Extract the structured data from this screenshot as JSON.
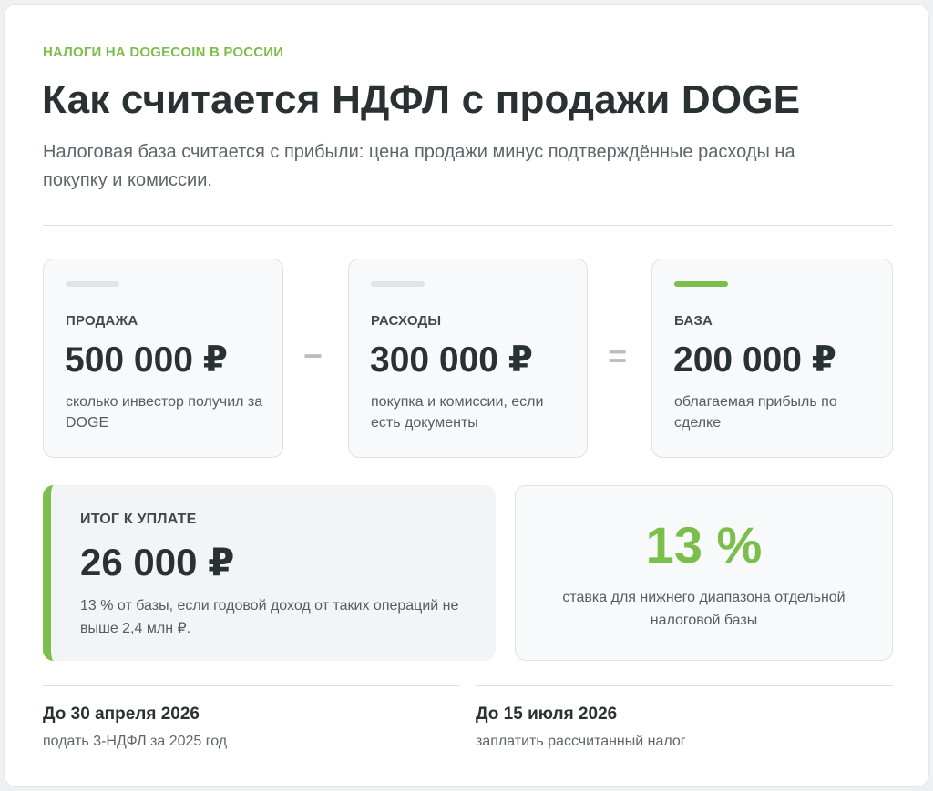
{
  "header": {
    "eyebrow": "НАЛОГИ НА DOGECOIN В РОССИИ",
    "title": "Как считается НДФЛ с продажи DOGE",
    "subtitle": "Налоговая база считается с прибыли: цена продажи минус подтверждённые расходы на покупку и комиссии."
  },
  "formula": {
    "operators": {
      "minus": "−",
      "equals": "="
    },
    "sale": {
      "label": "ПРОДАЖА",
      "value": "500 000 ₽",
      "description": "сколько инвестор получил за DOGE"
    },
    "expenses": {
      "label": "РАСХОДЫ",
      "value": "300 000 ₽",
      "description": "покупка и комиссии, если есть документы"
    },
    "base": {
      "label": "БАЗА",
      "value": "200 000 ₽",
      "description": "облагаемая прибыль по сделке"
    }
  },
  "total": {
    "label": "ИТОГ К УПЛАТЕ",
    "value": "26 000 ₽",
    "description": "13 % от базы, если годовой доход от таких операций не выше 2,4 млн ₽."
  },
  "rate": {
    "value": "13 %",
    "description": "ставка для нижнего диапазона отдельной налоговой базы"
  },
  "deadlines": [
    {
      "date": "До 30 апреля 2026",
      "note": "подать 3-НДФЛ за 2025 год"
    },
    {
      "date": "До 15 июля 2026",
      "note": "заплатить рассчитанный налог"
    }
  ],
  "colors": {
    "accent": "#7cbe4a",
    "text_dark": "#2a3133",
    "text_muted": "#5d666a"
  }
}
